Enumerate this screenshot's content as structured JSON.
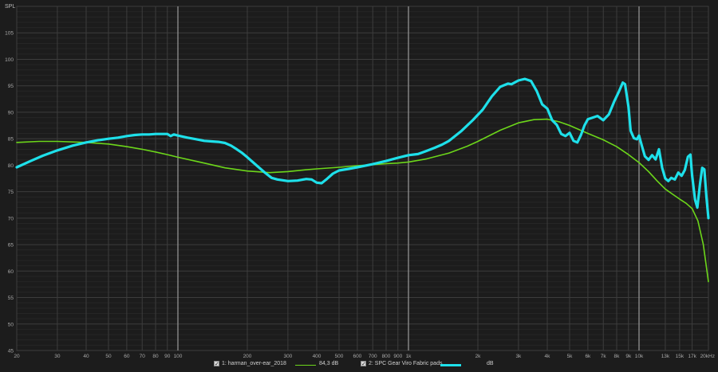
{
  "chart_data": {
    "type": "line",
    "title": "",
    "ylabel": "SPL",
    "xlabel": "",
    "x_scale": "log",
    "xlim": [
      20,
      20000
    ],
    "ylim": [
      45,
      110
    ],
    "y_ticks": [
      45,
      50,
      55,
      60,
      65,
      70,
      75,
      80,
      85,
      90,
      95,
      100,
      105
    ],
    "x_ticks": [
      {
        "v": 20,
        "label": "20",
        "major": false
      },
      {
        "v": 30,
        "label": "30",
        "major": false
      },
      {
        "v": 40,
        "label": "40",
        "major": false
      },
      {
        "v": 50,
        "label": "50",
        "major": false
      },
      {
        "v": 60,
        "label": "60",
        "major": false
      },
      {
        "v": 70,
        "label": "70",
        "major": false
      },
      {
        "v": 80,
        "label": "80",
        "major": false
      },
      {
        "v": 90,
        "label": "90",
        "major": false
      },
      {
        "v": 100,
        "label": "100",
        "major": true
      },
      {
        "v": 200,
        "label": "200",
        "major": false
      },
      {
        "v": 300,
        "label": "300",
        "major": false
      },
      {
        "v": 400,
        "label": "400",
        "major": false
      },
      {
        "v": 500,
        "label": "500",
        "major": false
      },
      {
        "v": 600,
        "label": "600",
        "major": false
      },
      {
        "v": 700,
        "label": "700",
        "major": false
      },
      {
        "v": 800,
        "label": "800",
        "major": false
      },
      {
        "v": 900,
        "label": "900",
        "major": false
      },
      {
        "v": 1000,
        "label": "1k",
        "major": true
      },
      {
        "v": 2000,
        "label": "2k",
        "major": false
      },
      {
        "v": 3000,
        "label": "3k",
        "major": false
      },
      {
        "v": 4000,
        "label": "4k",
        "major": false
      },
      {
        "v": 5000,
        "label": "5k",
        "major": false
      },
      {
        "v": 6000,
        "label": "6k",
        "major": false
      },
      {
        "v": 7000,
        "label": "7k",
        "major": false
      },
      {
        "v": 8000,
        "label": "8k",
        "major": false
      },
      {
        "v": 9000,
        "label": "9k",
        "major": false
      },
      {
        "v": 10000,
        "label": "10k",
        "major": true
      },
      {
        "v": 13000,
        "label": "13k",
        "major": false
      },
      {
        "v": 15000,
        "label": "15k",
        "major": false
      },
      {
        "v": 17000,
        "label": "17k",
        "major": false
      },
      {
        "v": 20000,
        "label": "20kHz",
        "major": false
      }
    ],
    "grid": true,
    "series": [
      {
        "name": "1: harman_over-ear_2018",
        "color": "#6cd61a",
        "legend_value": "84,3 dB",
        "points": [
          [
            20,
            84.3
          ],
          [
            25,
            84.5
          ],
          [
            30,
            84.5
          ],
          [
            40,
            84.3
          ],
          [
            50,
            84.0
          ],
          [
            60,
            83.5
          ],
          [
            70,
            83.0
          ],
          [
            80,
            82.5
          ],
          [
            90,
            82.0
          ],
          [
            100,
            81.5
          ],
          [
            130,
            80.4
          ],
          [
            160,
            79.5
          ],
          [
            200,
            78.9
          ],
          [
            250,
            78.6
          ],
          [
            300,
            78.8
          ],
          [
            350,
            79.1
          ],
          [
            400,
            79.3
          ],
          [
            500,
            79.6
          ],
          [
            600,
            79.9
          ],
          [
            700,
            80.1
          ],
          [
            800,
            80.3
          ],
          [
            900,
            80.4
          ],
          [
            1000,
            80.6
          ],
          [
            1200,
            81.2
          ],
          [
            1500,
            82.3
          ],
          [
            1800,
            83.6
          ],
          [
            2000,
            84.5
          ],
          [
            2500,
            86.6
          ],
          [
            3000,
            88.0
          ],
          [
            3500,
            88.6
          ],
          [
            4000,
            88.7
          ],
          [
            4500,
            88.2
          ],
          [
            5000,
            87.5
          ],
          [
            6000,
            86.0
          ],
          [
            7000,
            84.8
          ],
          [
            8000,
            83.5
          ],
          [
            9000,
            82.0
          ],
          [
            10000,
            80.5
          ],
          [
            11000,
            78.8
          ],
          [
            12000,
            77.0
          ],
          [
            13000,
            75.5
          ],
          [
            14000,
            74.5
          ],
          [
            15000,
            73.6
          ],
          [
            16000,
            72.8
          ],
          [
            17000,
            71.8
          ],
          [
            18000,
            69.5
          ],
          [
            19000,
            65.0
          ],
          [
            20000,
            58.0
          ]
        ]
      },
      {
        "name": "2: SPC Gear Viro Fabric pads",
        "color": "#1ee0ea",
        "legend_value": "dB",
        "points": [
          [
            20,
            79.6
          ],
          [
            23,
            80.8
          ],
          [
            26,
            81.8
          ],
          [
            30,
            82.8
          ],
          [
            35,
            83.7
          ],
          [
            40,
            84.3
          ],
          [
            45,
            84.7
          ],
          [
            50,
            85.0
          ],
          [
            55,
            85.2
          ],
          [
            60,
            85.5
          ],
          [
            65,
            85.7
          ],
          [
            70,
            85.8
          ],
          [
            75,
            85.8
          ],
          [
            80,
            85.9
          ],
          [
            85,
            85.9
          ],
          [
            90,
            85.9
          ],
          [
            93,
            85.5
          ],
          [
            96,
            85.8
          ],
          [
            100,
            85.6
          ],
          [
            110,
            85.2
          ],
          [
            120,
            84.9
          ],
          [
            130,
            84.6
          ],
          [
            140,
            84.5
          ],
          [
            150,
            84.4
          ],
          [
            160,
            84.2
          ],
          [
            170,
            83.7
          ],
          [
            180,
            83.0
          ],
          [
            190,
            82.3
          ],
          [
            200,
            81.5
          ],
          [
            220,
            79.9
          ],
          [
            240,
            78.5
          ],
          [
            255,
            77.6
          ],
          [
            270,
            77.3
          ],
          [
            300,
            77.0
          ],
          [
            330,
            77.1
          ],
          [
            360,
            77.4
          ],
          [
            380,
            77.3
          ],
          [
            400,
            76.7
          ],
          [
            420,
            76.6
          ],
          [
            440,
            77.3
          ],
          [
            470,
            78.4
          ],
          [
            500,
            79.0
          ],
          [
            550,
            79.3
          ],
          [
            600,
            79.6
          ],
          [
            700,
            80.2
          ],
          [
            800,
            80.8
          ],
          [
            900,
            81.4
          ],
          [
            1000,
            81.9
          ],
          [
            1100,
            82.1
          ],
          [
            1200,
            82.7
          ],
          [
            1300,
            83.3
          ],
          [
            1400,
            83.9
          ],
          [
            1500,
            84.6
          ],
          [
            1700,
            86.5
          ],
          [
            1900,
            88.5
          ],
          [
            2100,
            90.5
          ],
          [
            2300,
            93.0
          ],
          [
            2500,
            94.8
          ],
          [
            2700,
            95.4
          ],
          [
            2800,
            95.3
          ],
          [
            3000,
            96.0
          ],
          [
            3200,
            96.3
          ],
          [
            3400,
            95.9
          ],
          [
            3600,
            94.0
          ],
          [
            3800,
            91.5
          ],
          [
            4000,
            90.7
          ],
          [
            4200,
            88.5
          ],
          [
            4400,
            87.6
          ],
          [
            4600,
            85.9
          ],
          [
            4800,
            85.5
          ],
          [
            5000,
            86.1
          ],
          [
            5200,
            84.6
          ],
          [
            5400,
            84.3
          ],
          [
            5600,
            85.7
          ],
          [
            5800,
            87.5
          ],
          [
            6000,
            88.7
          ],
          [
            6300,
            89.0
          ],
          [
            6600,
            89.3
          ],
          [
            7000,
            88.5
          ],
          [
            7400,
            89.6
          ],
          [
            7800,
            92.0
          ],
          [
            8200,
            94.0
          ],
          [
            8500,
            95.6
          ],
          [
            8700,
            95.3
          ],
          [
            9000,
            91.0
          ],
          [
            9200,
            86.5
          ],
          [
            9500,
            85.1
          ],
          [
            9800,
            84.9
          ],
          [
            10000,
            85.6
          ],
          [
            10300,
            83.6
          ],
          [
            10600,
            81.7
          ],
          [
            11000,
            81.0
          ],
          [
            11400,
            81.9
          ],
          [
            11800,
            81.1
          ],
          [
            12200,
            83.0
          ],
          [
            12600,
            79.5
          ],
          [
            13000,
            77.5
          ],
          [
            13400,
            77.0
          ],
          [
            13800,
            77.6
          ],
          [
            14300,
            77.3
          ],
          [
            14800,
            78.6
          ],
          [
            15300,
            78.0
          ],
          [
            15800,
            79.1
          ],
          [
            16300,
            81.6
          ],
          [
            16700,
            82.0
          ],
          [
            17000,
            78.0
          ],
          [
            17500,
            73.5
          ],
          [
            17900,
            72.0
          ],
          [
            18400,
            76.5
          ],
          [
            18800,
            79.5
          ],
          [
            19200,
            79.2
          ],
          [
            19600,
            74.0
          ],
          [
            20000,
            70.0
          ]
        ]
      }
    ],
    "legend_position": "bottom"
  }
}
